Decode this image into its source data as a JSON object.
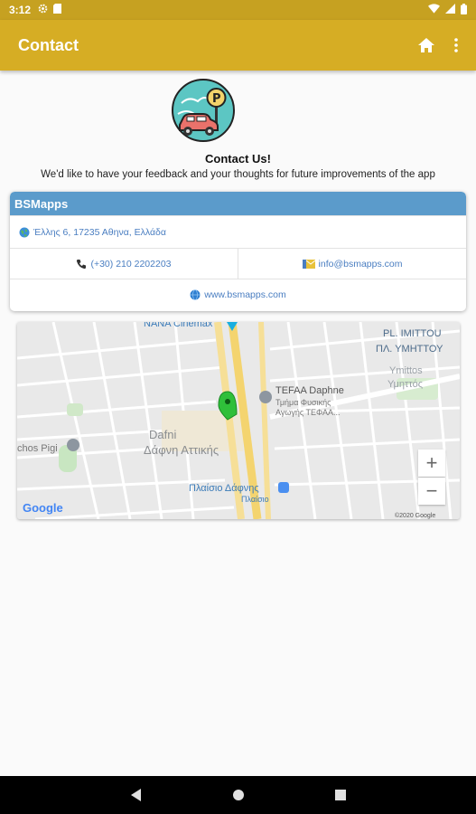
{
  "status_bar": {
    "time": "3:12"
  },
  "app_bar": {
    "title": "Contact"
  },
  "header": {
    "title": "Contact Us!",
    "subtitle": "We'd like to have your feedback and your thoughts for future improvements of the app"
  },
  "card": {
    "title": "BSMapps",
    "address": "Έλλης 6, 17235 Αθηνα, Ελλάδα",
    "phone": "(+30) 210 2202203",
    "email": "info@bsmapps.com",
    "website": "www.bsmapps.com"
  },
  "map": {
    "labels": {
      "nana": "NANA Cinemax",
      "pl_imittou": "PL. IMITTOU",
      "pl_ymittou": "ΠΛ. ΥΜΗΤΤΟΥ",
      "ymittos_en": "Ymittos",
      "ymittos_gr": "Υμηττός",
      "tefaa": "TEFAA Daphne",
      "tefaa_sub1": "Τμήμα Φυσικής",
      "tefaa_sub2": "Αγωγής ΤΕΦΑΑ...",
      "dafni_en": "Dafni",
      "dafni_gr": "Δάφνη Αττικής",
      "pigi": "chos Pigi",
      "plaisio_title": "Πλαίσιο Δάφνης",
      "plaisio_sub": "Πλαίσιο",
      "google": "Google",
      "copyright": "©2020 Google"
    },
    "zoom_in": "+",
    "zoom_out": "−"
  }
}
